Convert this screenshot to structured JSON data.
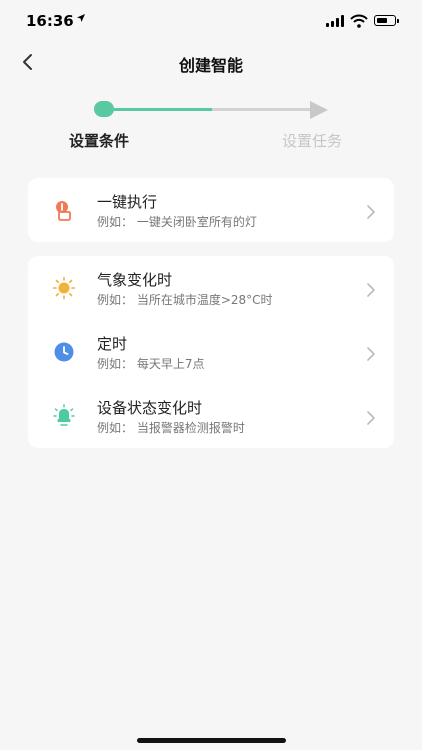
{
  "status": {
    "time": "16:36",
    "location_icon": "location-arrow-icon"
  },
  "nav": {
    "title": "创建智能",
    "back_icon": "chevron-left-icon"
  },
  "stepper": {
    "steps": [
      {
        "label": "设置条件",
        "active": true
      },
      {
        "label": "设置任务",
        "active": false
      }
    ],
    "colors": {
      "active": "#58c9a0",
      "inactive": "#d2d2d2"
    }
  },
  "groups": [
    {
      "items": [
        {
          "title": "一键执行",
          "desc": "例如：  一键关闭卧室所有的灯",
          "icon": "tap-hand-icon",
          "color": "#f07a55"
        }
      ]
    },
    {
      "items": [
        {
          "title": "气象变化时",
          "desc": "例如：  当所在城市温度>28°C时",
          "icon": "sun-icon",
          "color": "#f3b13a"
        },
        {
          "title": "定时",
          "desc": "例如：  每天早上7点",
          "icon": "clock-icon",
          "color": "#4f8ee6"
        },
        {
          "title": "设备状态变化时",
          "desc": "例如：  当报警器检测报警时",
          "icon": "alarm-device-icon",
          "color": "#4ccaa0"
        }
      ]
    }
  ]
}
